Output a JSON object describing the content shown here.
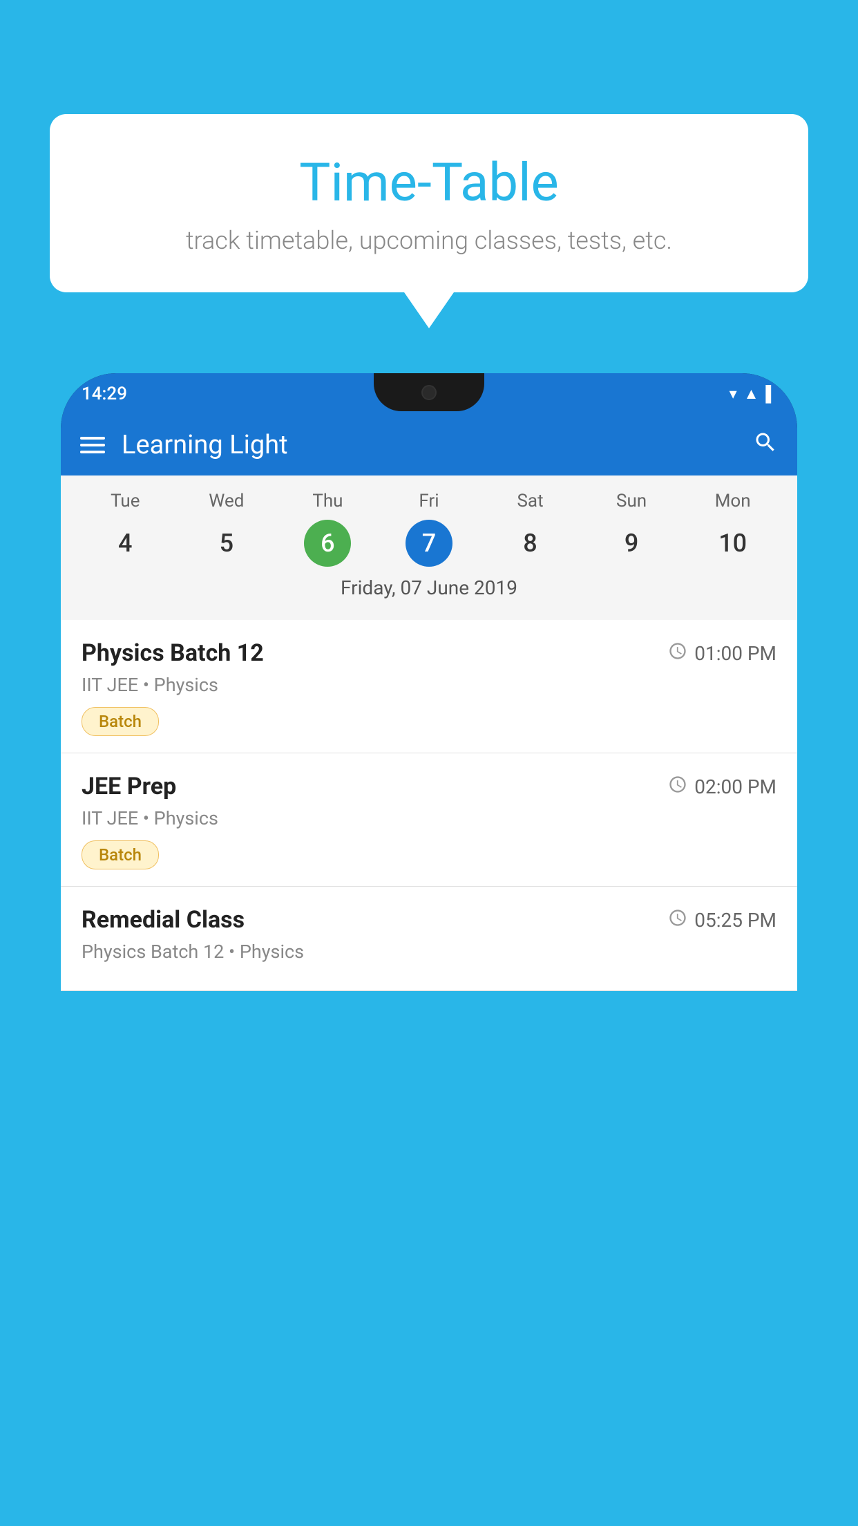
{
  "background_color": "#29b6e8",
  "speech_bubble": {
    "title": "Time-Table",
    "subtitle": "track timetable, upcoming classes, tests, etc."
  },
  "phone": {
    "status_bar": {
      "time": "14:29",
      "signal_icons": "▼◀▌"
    },
    "app_header": {
      "title": "Learning Light",
      "menu_icon": "hamburger",
      "search_icon": "search"
    },
    "calendar": {
      "days": [
        {
          "label": "Tue",
          "number": "4",
          "state": "normal"
        },
        {
          "label": "Wed",
          "number": "5",
          "state": "normal"
        },
        {
          "label": "Thu",
          "number": "6",
          "state": "today"
        },
        {
          "label": "Fri",
          "number": "7",
          "state": "selected"
        },
        {
          "label": "Sat",
          "number": "8",
          "state": "normal"
        },
        {
          "label": "Sun",
          "number": "9",
          "state": "normal"
        },
        {
          "label": "Mon",
          "number": "10",
          "state": "normal"
        }
      ],
      "selected_date_label": "Friday, 07 June 2019"
    },
    "schedule_items": [
      {
        "title": "Physics Batch 12",
        "time": "01:00 PM",
        "meta": "IIT JEE • Physics",
        "badge": "Batch"
      },
      {
        "title": "JEE Prep",
        "time": "02:00 PM",
        "meta": "IIT JEE • Physics",
        "badge": "Batch"
      },
      {
        "title": "Remedial Class",
        "time": "05:25 PM",
        "meta": "Physics Batch 12 • Physics",
        "badge": null
      }
    ]
  }
}
